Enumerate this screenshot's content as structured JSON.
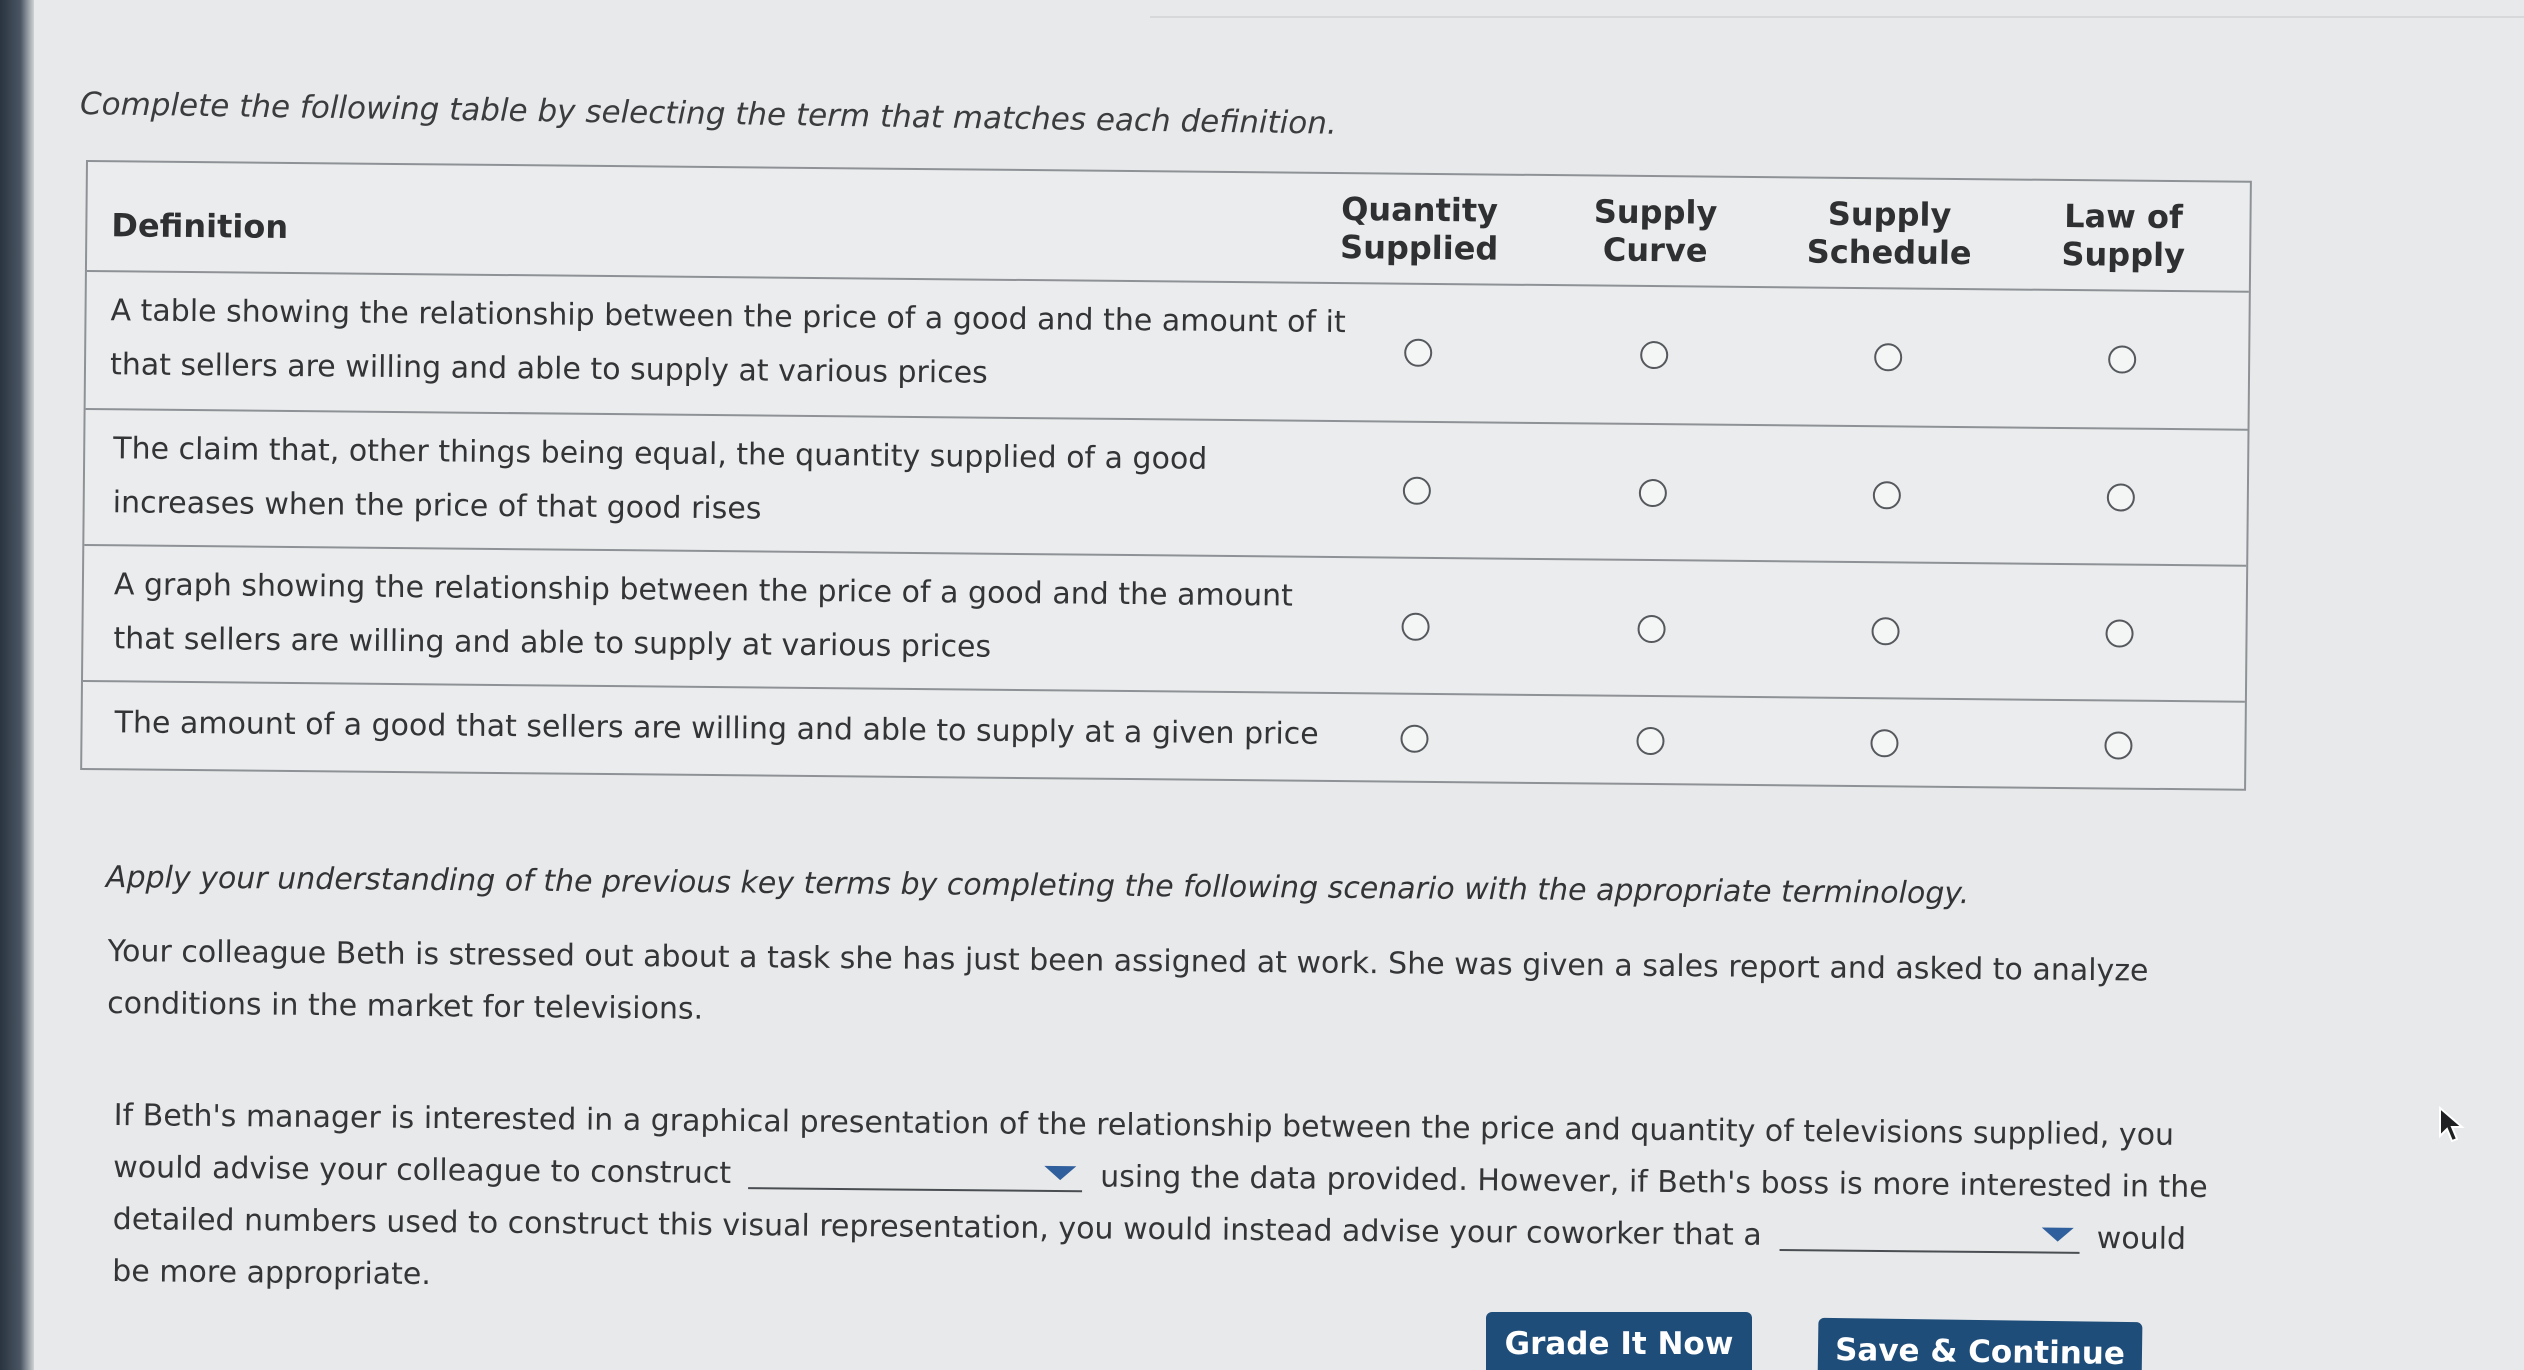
{
  "intro_text": "Complete the following table by selecting the term that matches each definition.",
  "table": {
    "definition_header": "Definition",
    "columns": [
      {
        "line1": "Quantity",
        "line2": "Supplied"
      },
      {
        "line1": "Supply",
        "line2": "Curve"
      },
      {
        "line1": "Supply",
        "line2": "Schedule"
      },
      {
        "line1": "Law of",
        "line2": "Supply"
      }
    ],
    "rows": [
      {
        "definition": "A table showing the relationship between the price of a good and the amount of it that sellers are willing and able to supply at various prices"
      },
      {
        "definition": "The claim that, other things being equal, the quantity supplied of a good increases when the price of that good rises"
      },
      {
        "definition": "A graph showing the relationship between the price of a good and the amount that sellers are willing and able to supply at various prices"
      },
      {
        "definition": "The amount of a good that sellers are willing and able to supply at a given price"
      }
    ]
  },
  "apply_text": "Apply your understanding of the previous key terms by completing the following scenario with the appropriate terminology.",
  "scenario": {
    "paragraph1": "Your colleague Beth is stressed out about a task she has just been assigned at work. She was given a sales report and asked to analyze conditions in the market for televisions.",
    "p2_part1": "If Beth's manager is interested in a graphical presentation of the relationship between the price and quantity of televisions supplied, you would advise your colleague to construct",
    "p2_part2": "using the data provided. However, if Beth's boss is more interested in the detailed numbers used to construct this visual representation, you would instead advise your coworker that a",
    "p2_part3": "would be more appropriate.",
    "dropdown1_value": "",
    "dropdown2_value": ""
  },
  "buttons": {
    "grade": "Grade It Now",
    "save": "Save & Continue"
  },
  "icons": {
    "dropdown": "caret-down-icon",
    "pointer": "mouse-pointer-icon"
  },
  "colors": {
    "button_bg": "#1f4d7a",
    "caret": "#2f5f9c"
  }
}
